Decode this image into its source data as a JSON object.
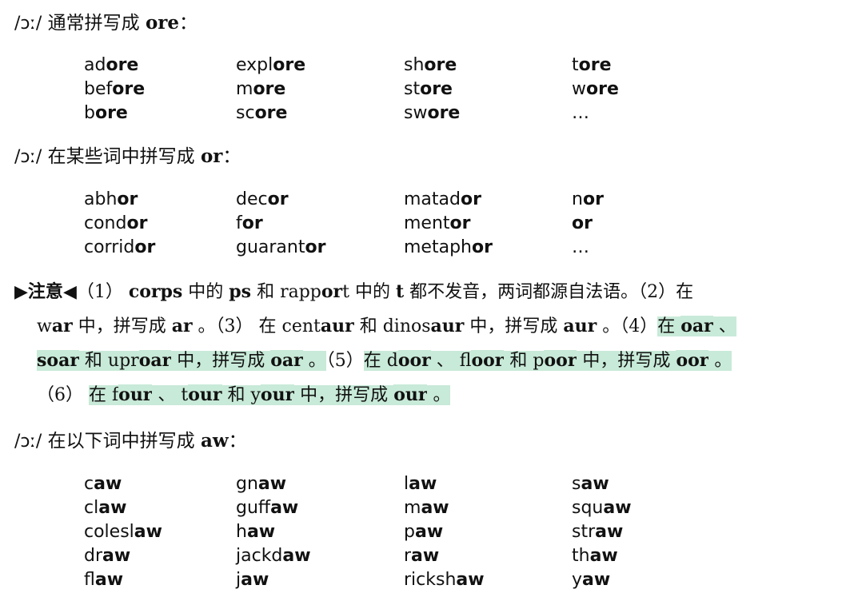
{
  "sections": [
    {
      "heading": {
        "ipa": "/ɔː/",
        "prefix": " 通常拼写成 ",
        "bold": "ore",
        "suffix": "："
      },
      "rows": [
        [
          [
            "ad",
            "ore"
          ],
          [
            "expl",
            "ore"
          ],
          [
            "sh",
            "ore"
          ],
          [
            "t",
            "ore"
          ]
        ],
        [
          [
            "bef",
            "ore"
          ],
          [
            "m",
            "ore"
          ],
          [
            "st",
            "ore"
          ],
          [
            "w",
            "ore"
          ]
        ],
        [
          [
            "b",
            "ore"
          ],
          [
            "sc",
            "ore"
          ],
          [
            "sw",
            "ore"
          ],
          [
            "…",
            ""
          ]
        ]
      ]
    },
    {
      "heading": {
        "ipa": "/ɔː/",
        "prefix": " 在某些词中拼写成 ",
        "bold": "or",
        "suffix": "："
      },
      "rows": [
        [
          [
            "abh",
            "or"
          ],
          [
            "dec",
            "or"
          ],
          [
            "matad",
            "or"
          ],
          [
            "n",
            "or"
          ]
        ],
        [
          [
            "cond",
            "or"
          ],
          [
            "f",
            "or"
          ],
          [
            "ment",
            "or"
          ],
          [
            "",
            "or"
          ]
        ],
        [
          [
            "corrid",
            "or"
          ],
          [
            "guarant",
            "or"
          ],
          [
            "metaph",
            "or"
          ],
          [
            "…",
            ""
          ]
        ]
      ]
    },
    {
      "heading": {
        "ipa": "/ɔː/",
        "prefix": " 在以下词中拼写成 ",
        "bold": "aw",
        "suffix": "："
      },
      "rows": [
        [
          [
            "c",
            "aw"
          ],
          [
            "gn",
            "aw"
          ],
          [
            "l",
            "aw"
          ],
          [
            "s",
            "aw"
          ]
        ],
        [
          [
            "cl",
            "aw"
          ],
          [
            "guff",
            "aw"
          ],
          [
            "m",
            "aw"
          ],
          [
            "squ",
            "aw"
          ]
        ],
        [
          [
            "colesl",
            "aw"
          ],
          [
            "h",
            "aw"
          ],
          [
            "p",
            "aw"
          ],
          [
            "str",
            "aw"
          ]
        ],
        [
          [
            "dr",
            "aw"
          ],
          [
            "jackd",
            "aw"
          ],
          [
            "r",
            "aw"
          ],
          [
            "th",
            "aw"
          ]
        ],
        [
          [
            "fl",
            "aw"
          ],
          [
            "j",
            "aw"
          ],
          [
            "ricksh",
            "aw"
          ],
          [
            "y",
            "aw"
          ]
        ]
      ]
    }
  ],
  "note": {
    "label": "注意",
    "marker_start": "▶",
    "marker_end": "◀",
    "line1": [
      {
        "t": "（1） "
      },
      {
        "t": "corps",
        "b": true
      },
      {
        "t": " 中的 "
      },
      {
        "t": "ps",
        "b": true
      },
      {
        "t": " 和 rapp"
      },
      {
        "t": "or",
        "b": true
      },
      {
        "t": "t 中的 "
      },
      {
        "t": "t",
        "b": true
      },
      {
        "t": " 都不发音，两词都源自法语。（2）在"
      }
    ],
    "line2": [
      {
        "t": "w"
      },
      {
        "t": "ar",
        "b": true
      },
      {
        "t": " 中，拼写成 "
      },
      {
        "t": "ar",
        "b": true
      },
      {
        "t": " 。（3） 在 cent"
      },
      {
        "t": "aur",
        "b": true
      },
      {
        "t": " 和 dinos"
      },
      {
        "t": "aur",
        "b": true
      },
      {
        "t": " 中，拼写成 "
      },
      {
        "t": "aur",
        "b": true
      },
      {
        "t": " 。（4）"
      },
      {
        "t": "在 ",
        "h": true
      },
      {
        "t": "oar",
        "b": true,
        "h": true
      },
      {
        "t": " 、",
        "h": true
      }
    ],
    "line3": [
      {
        "t": "s",
        "b": true,
        "h": true
      },
      {
        "t": "oar",
        "b": true,
        "h": true
      },
      {
        "t": " 和 upr",
        "h": true
      },
      {
        "t": "oar",
        "b": true,
        "h": true
      },
      {
        "t": " 中，拼写成 ",
        "h": true
      },
      {
        "t": "oar",
        "b": true,
        "h": true
      },
      {
        "t": " 。",
        "h": true
      },
      {
        "t": "（5）"
      },
      {
        "t": "在 d",
        "h": true
      },
      {
        "t": "oor",
        "b": true,
        "h": true
      },
      {
        "t": " 、 fl",
        "h": true
      },
      {
        "t": "oor",
        "b": true,
        "h": true
      },
      {
        "t": " 和 p",
        "h": true
      },
      {
        "t": "oor",
        "b": true,
        "h": true
      },
      {
        "t": " 中，拼写成 ",
        "h": true
      },
      {
        "t": "oor",
        "b": true,
        "h": true
      },
      {
        "t": " 。",
        "h": true
      }
    ],
    "line4": [
      {
        "t": "（6） "
      },
      {
        "t": " 在 f",
        "h": true
      },
      {
        "t": "our",
        "b": true,
        "h": true
      },
      {
        "t": " 、 t",
        "h": true
      },
      {
        "t": "our",
        "b": true,
        "h": true
      },
      {
        "t": " 和 y",
        "h": true
      },
      {
        "t": "our",
        "b": true,
        "h": true
      },
      {
        "t": " 中，拼写成 ",
        "h": true
      },
      {
        "t": "our",
        "b": true,
        "h": true
      },
      {
        "t": " 。",
        "h": true
      }
    ]
  }
}
